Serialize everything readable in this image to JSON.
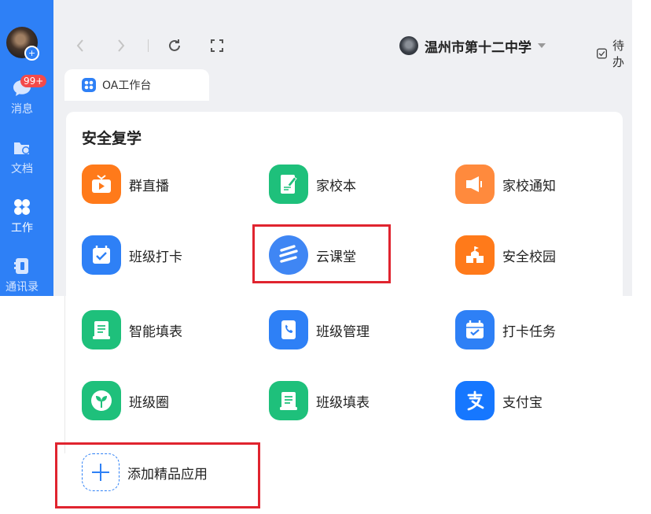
{
  "sidebar": {
    "items": [
      {
        "label": "消息",
        "icon": "chat-icon",
        "badge": "99+"
      },
      {
        "label": "文档",
        "icon": "folder-icon"
      },
      {
        "label": "工作",
        "icon": "work-grid-icon"
      },
      {
        "label": "通讯录",
        "icon": "contacts-icon"
      }
    ]
  },
  "toolbar": {
    "org_name": "温州市第十二中学",
    "todo_label": "待办"
  },
  "tab": {
    "label": "OA工作台"
  },
  "section": {
    "title": "安全复学"
  },
  "apps": [
    {
      "label": "群直播",
      "icon": "live-tv-icon",
      "color": "#ff7a1a"
    },
    {
      "label": "家校本",
      "icon": "notebook-pen-icon",
      "color": "#1ec07b"
    },
    {
      "label": "家校通知",
      "icon": "megaphone-icon",
      "color": "#ff8a3d"
    },
    {
      "label": "班级打卡",
      "icon": "calendar-check-icon",
      "color": "#2e80f6"
    },
    {
      "label": "云课堂",
      "icon": "cloud-class-icon",
      "color": "#3f86f4"
    },
    {
      "label": "安全校园",
      "icon": "school-building-icon",
      "color": "#ff7a1a"
    },
    {
      "label": "智能填表",
      "icon": "smart-form-icon",
      "color": "#1ec07b"
    },
    {
      "label": "班级管理",
      "icon": "class-contacts-icon",
      "color": "#2e80f6"
    },
    {
      "label": "打卡任务",
      "icon": "checkin-task-icon",
      "color": "#2e80f6"
    },
    {
      "label": "班级圈",
      "icon": "sprout-circle-icon",
      "color": "#1ec07b"
    },
    {
      "label": "班级填表",
      "icon": "class-form-icon",
      "color": "#1ec07b"
    },
    {
      "label": "支付宝",
      "icon": "alipay-icon",
      "color": "#1677ff"
    }
  ],
  "add_app": {
    "label": "添加精品应用",
    "icon": "plus-icon"
  },
  "colors": {
    "accent": "#2e80f6",
    "highlight": "#e0242f",
    "background": "#eff0f3"
  }
}
